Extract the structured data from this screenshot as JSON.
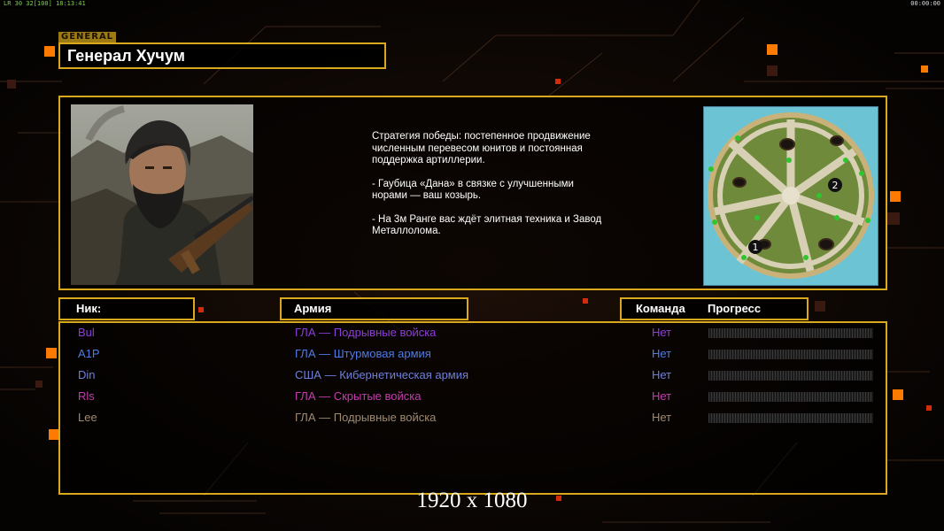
{
  "top_bar": {
    "left_text": "LR 30 32[100] 18:13:41",
    "right_text": "00:00:00"
  },
  "general": {
    "tag": "GENERAL",
    "name": "Генерал Хучум"
  },
  "strategy": {
    "p1": "Стратегия победы: постепенное продвижение численным перевесом юнитов и постоянная поддержка артиллерии.",
    "p2": "- Гаубица «Дана» в связке с улучшенными норами — ваш козырь.",
    "p3": "- На 3м Ранге вас ждёт элитная техника и Завод Металлолома."
  },
  "minimap": {
    "markers": [
      "1",
      "2"
    ]
  },
  "headers": {
    "nick": "Ник:",
    "army": "Армия",
    "team": "Команда",
    "progress": "Прогресс"
  },
  "players": [
    {
      "nick": "Bul",
      "army": "ГЛА — Подрывные войска",
      "team": "Нет",
      "color": "#8a3fd6"
    },
    {
      "nick": "A1P",
      "army": "ГЛА — Штурмовая армия",
      "team": "Нет",
      "color": "#4f7be3"
    },
    {
      "nick": "Din",
      "army": "США — Кибернетическая армия",
      "team": "Нет",
      "color": "#6f7fd9"
    },
    {
      "nick": "Rls",
      "army": "ГЛА — Скрытые войска",
      "team": "Нет",
      "color": "#c63bb0"
    },
    {
      "nick": "Lee",
      "army": "ГЛА — Подрывные войска",
      "team": "Нет",
      "color": "#9f8a72"
    }
  ],
  "resolution": "1920 x 1080",
  "colors": {
    "accent": "#d9a81c",
    "orange": "#ff7a00",
    "red": "#d42b0c"
  }
}
